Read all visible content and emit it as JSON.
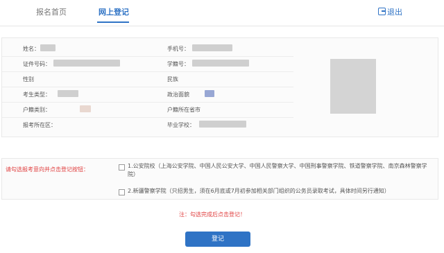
{
  "nav": {
    "tab_home": "报名首页",
    "tab_register": "网上登记",
    "logout": "退出"
  },
  "info": {
    "name_label": "姓名：",
    "phone_label": "手机号：",
    "id_label": "证件号码：",
    "student_id_label": "学籍号：",
    "gender_label": "性别",
    "ethnicity_label": "民族",
    "candidate_type_label": "考生类型：",
    "political_label": "政治面貌",
    "hukou_type_label": "户籍类别：",
    "hukou_city_label": "户籍所在省市",
    "exam_location_label": "报考所在区：",
    "school_label": "毕业学校："
  },
  "registration": {
    "prompt": "请勾选报考意向并点击登记按钮：",
    "option1": "1.公安院校（上海公安学院、中国人民公安大学、中国人民警察大学、中国刑事警察学院、铁道警察学院、南京森林警察学院）",
    "option2": "2.新疆警察学院（只招男生，须在6月底或7月初参加相关部门组织的公务员录取考试，具体时间另行通知）",
    "note": "注：勾选完成后点击登记！",
    "submit": "登记"
  },
  "colors": {
    "accent": "#2f73c5",
    "warning": "#e04040"
  }
}
